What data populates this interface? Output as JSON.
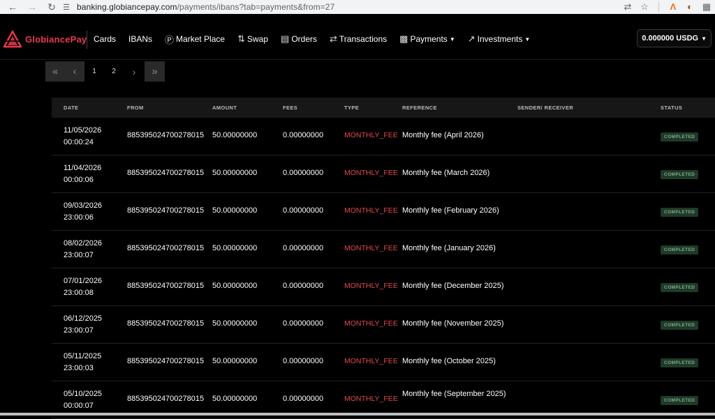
{
  "browser": {
    "url_domain": "banking.globiancepay.com",
    "url_path": "/payments/ibans?tab=payments&from=27"
  },
  "brand": {
    "name": "GlobiancePay",
    "accent": "#e8394f"
  },
  "nav": {
    "cards": "Cards",
    "ibans": "IBANs",
    "market_place": "Market Place",
    "swap": "Swap",
    "orders": "Orders",
    "transactions": "Transactions",
    "payments": "Payments",
    "investments": "Investments"
  },
  "balance": "0.000000 USDG",
  "pagination": {
    "pages": [
      "1",
      "2"
    ]
  },
  "table": {
    "headers": {
      "date": "DATE",
      "from": "FROM",
      "amount": "AMOUNT",
      "fees": "FEES",
      "type": "TYPE",
      "reference": "REFERENCE",
      "sender_receiver": "SENDER/ RECEIVER",
      "status": "STATUS"
    },
    "rows": [
      {
        "date": "11/05/2026",
        "time": "00:00:24",
        "from": "885395024700278015",
        "amount": "50.00000000",
        "fees": "0.00000000",
        "type": "MONTHLY_FEE",
        "reference": "Monthly fee (April 2026)",
        "status": "COMPLETED"
      },
      {
        "date": "11/04/2026",
        "time": "00:00:06",
        "from": "885395024700278015",
        "amount": "50.00000000",
        "fees": "0.00000000",
        "type": "MONTHLY_FEE",
        "reference": "Monthly fee (March 2026)",
        "status": "COMPLETED"
      },
      {
        "date": "09/03/2026",
        "time": "23:00:06",
        "from": "885395024700278015",
        "amount": "50.00000000",
        "fees": "0.00000000",
        "type": "MONTHLY_FEE",
        "reference": "Monthly fee (February 2026)",
        "status": "COMPLETED"
      },
      {
        "date": "08/02/2026",
        "time": "23:00:07",
        "from": "885395024700278015",
        "amount": "50.00000000",
        "fees": "0.00000000",
        "type": "MONTHLY_FEE",
        "reference": "Monthly fee (January 2026)",
        "status": "COMPLETED"
      },
      {
        "date": "07/01/2026",
        "time": "23:00:08",
        "from": "885395024700278015",
        "amount": "50.00000000",
        "fees": "0.00000000",
        "type": "MONTHLY_FEE",
        "reference": "Monthly fee (December 2025)",
        "status": "COMPLETED"
      },
      {
        "date": "06/12/2025",
        "time": "23:00:07",
        "from": "885395024700278015",
        "amount": "50.00000000",
        "fees": "0.00000000",
        "type": "MONTHLY_FEE",
        "reference": "Monthly fee (November 2025)",
        "status": "COMPLETED"
      },
      {
        "date": "05/11/2025",
        "time": "23:00:03",
        "from": "885395024700278015",
        "amount": "50.00000000",
        "fees": "0.00000000",
        "type": "MONTHLY_FEE",
        "reference": "Monthly fee (October 2025)",
        "status": "COMPLETED"
      },
      {
        "date": "05/10/2025",
        "time": "00:00:07",
        "from": "885395024700278015",
        "amount": "50.00000000",
        "fees": "0.00000000",
        "type": "MONTHLY_FEE",
        "reference": "Monthly fee (September 2025)",
        "status": "COMPLETED"
      }
    ]
  }
}
